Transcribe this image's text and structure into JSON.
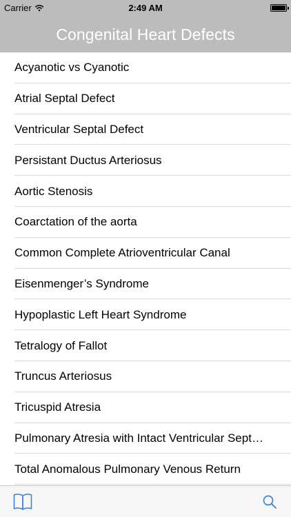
{
  "status_bar": {
    "carrier": "Carrier",
    "time": "2:49 AM",
    "battery_level": 1.0
  },
  "nav": {
    "title": "Congenital Heart Defects"
  },
  "list": {
    "items": [
      "Acyanotic vs Cyanotic",
      "Atrial Septal Defect",
      "Ventricular Septal Defect",
      "Persistant Ductus Arteriosus",
      "Aortic Stenosis",
      "Coarctation of the aorta",
      "Common Complete Atrioventricular Canal",
      "Eisenmenger’s Syndrome",
      "Hypoplastic Left Heart Syndrome",
      "Tetralogy of Fallot",
      "Truncus Arteriosus",
      "Tricuspid Atresia",
      "Pulmonary Atresia with Intact Ventricular Sept…",
      "Total Anomalous Pulmonary Venous Return"
    ]
  },
  "tab_bar": {
    "left_icon": "book-icon",
    "right_icon": "search-icon",
    "accent_color": "#3d84d8"
  }
}
